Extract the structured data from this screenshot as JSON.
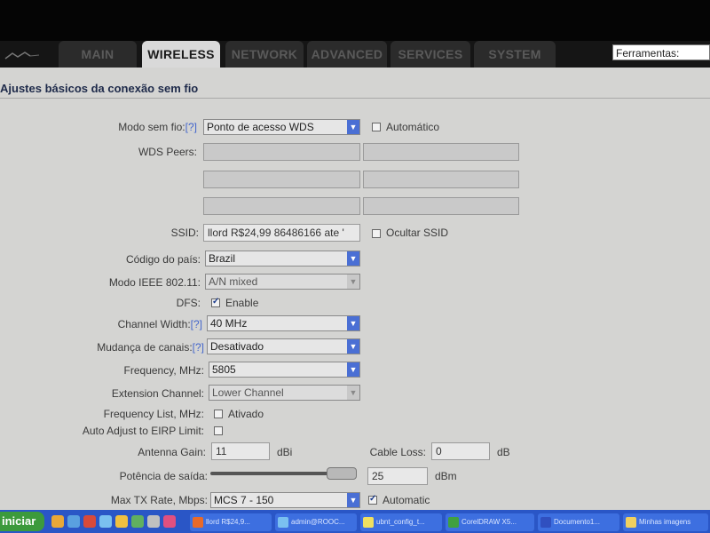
{
  "nav": {
    "tabs": [
      {
        "label": "MAIN"
      },
      {
        "label": "WIRELESS"
      },
      {
        "label": "NETWORK"
      },
      {
        "label": "ADVANCED"
      },
      {
        "label": "SERVICES"
      },
      {
        "label": "SYSTEM"
      }
    ],
    "active_tab": "WIRELESS",
    "tools_value": "Ferramentas:"
  },
  "page": {
    "title": "Ajustes básicos da conexão sem fio"
  },
  "form": {
    "wireless_mode": {
      "label": "Modo sem fio:",
      "help": "[?]",
      "value": "Ponto de acesso WDS"
    },
    "auto": {
      "label": "Automático",
      "checked": false
    },
    "wds_peers": {
      "label": "WDS Peers:",
      "values": [
        "",
        "",
        "",
        "",
        "",
        ""
      ]
    },
    "ssid": {
      "label": "SSID:",
      "value": "llord R$24,99 86486166 ate '"
    },
    "hide_ssid": {
      "label": "Ocultar SSID",
      "checked": false
    },
    "country": {
      "label": "Código do país:",
      "value": "Brazil"
    },
    "ieee_mode": {
      "label": "Modo IEEE 802.11:",
      "value": "A/N mixed"
    },
    "dfs": {
      "label": "DFS:",
      "option": "Enable",
      "checked": true
    },
    "channel_width": {
      "label": "Channel Width:",
      "help": "[?]",
      "value": "40 MHz"
    },
    "channel_shifting": {
      "label": "Mudança de canais:",
      "help": "[?]",
      "value": "Desativado"
    },
    "frequency": {
      "label": "Frequency, MHz:",
      "value": "5805"
    },
    "extension_channel": {
      "label": "Extension Channel:",
      "value": "Lower Channel"
    },
    "frequency_list": {
      "label": "Frequency List, MHz:",
      "option": "Ativado",
      "checked": false
    },
    "eirp": {
      "label": "Auto Adjust to EIRP Limit:",
      "checked": false
    },
    "antenna_gain": {
      "label": "Antenna Gain:",
      "value": "11",
      "unit": "dBi"
    },
    "cable_loss": {
      "label": "Cable Loss:",
      "value": "0",
      "unit": "dB"
    },
    "output_power": {
      "label": "Potência de saída:",
      "value": "25",
      "unit": "dBm",
      "level": 0.92
    },
    "max_tx_rate": {
      "label": "Max TX Rate, Mbps:",
      "value": "MCS 7 - 150"
    },
    "tx_automatic": {
      "label": "Automatic",
      "checked": true
    }
  },
  "taskbar": {
    "start_label": "iniciar",
    "tasks": [
      {
        "label": "llord R$24,9..."
      },
      {
        "label": "admin@ROOC..."
      },
      {
        "label": "ubnt_config_t..."
      },
      {
        "label": "CorelDRAW X5..."
      },
      {
        "label": "Documento1..."
      },
      {
        "label": "Minhas imagens"
      }
    ]
  },
  "colors": {
    "accent_blue": "#4a6fd4",
    "content_bg": "#d4d4d2",
    "taskbar_blue": "#2a56c6",
    "start_green": "#3c9a3c"
  }
}
